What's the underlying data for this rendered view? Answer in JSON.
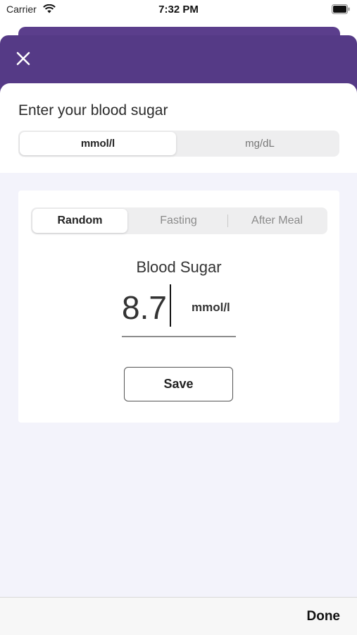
{
  "status_bar": {
    "carrier": "Carrier",
    "time": "7:32 PM"
  },
  "modal": {
    "title": "Enter your blood sugar",
    "unit_options": [
      "mmol/l",
      "mg/dL"
    ],
    "selected_unit": "mmol/l"
  },
  "entry": {
    "type_options": [
      "Random",
      "Fasting",
      "After Meal"
    ],
    "selected_type": "Random",
    "value_label": "Blood Sugar",
    "value": "8.7",
    "unit": "mmol/l",
    "save_label": "Save"
  },
  "footer": {
    "done_label": "Done"
  },
  "colors": {
    "header_purple": "#553a86",
    "content_background": "#f3f3fb"
  },
  "icons": {
    "close": "close-icon",
    "wifi": "wifi-icon",
    "battery": "battery-icon"
  }
}
